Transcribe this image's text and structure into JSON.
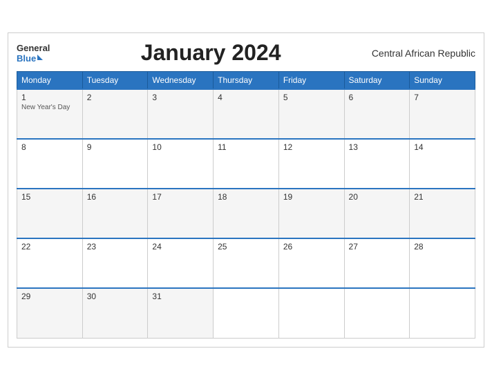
{
  "header": {
    "logo_general": "General",
    "logo_blue": "Blue",
    "title": "January 2024",
    "country": "Central African Republic"
  },
  "weekdays": [
    "Monday",
    "Tuesday",
    "Wednesday",
    "Thursday",
    "Friday",
    "Saturday",
    "Sunday"
  ],
  "weeks": [
    [
      {
        "day": "1",
        "holiday": "New Year's Day"
      },
      {
        "day": "2",
        "holiday": ""
      },
      {
        "day": "3",
        "holiday": ""
      },
      {
        "day": "4",
        "holiday": ""
      },
      {
        "day": "5",
        "holiday": ""
      },
      {
        "day": "6",
        "holiday": ""
      },
      {
        "day": "7",
        "holiday": ""
      }
    ],
    [
      {
        "day": "8",
        "holiday": ""
      },
      {
        "day": "9",
        "holiday": ""
      },
      {
        "day": "10",
        "holiday": ""
      },
      {
        "day": "11",
        "holiday": ""
      },
      {
        "day": "12",
        "holiday": ""
      },
      {
        "day": "13",
        "holiday": ""
      },
      {
        "day": "14",
        "holiday": ""
      }
    ],
    [
      {
        "day": "15",
        "holiday": ""
      },
      {
        "day": "16",
        "holiday": ""
      },
      {
        "day": "17",
        "holiday": ""
      },
      {
        "day": "18",
        "holiday": ""
      },
      {
        "day": "19",
        "holiday": ""
      },
      {
        "day": "20",
        "holiday": ""
      },
      {
        "day": "21",
        "holiday": ""
      }
    ],
    [
      {
        "day": "22",
        "holiday": ""
      },
      {
        "day": "23",
        "holiday": ""
      },
      {
        "day": "24",
        "holiday": ""
      },
      {
        "day": "25",
        "holiday": ""
      },
      {
        "day": "26",
        "holiday": ""
      },
      {
        "day": "27",
        "holiday": ""
      },
      {
        "day": "28",
        "holiday": ""
      }
    ],
    [
      {
        "day": "29",
        "holiday": ""
      },
      {
        "day": "30",
        "holiday": ""
      },
      {
        "day": "31",
        "holiday": ""
      },
      {
        "day": "",
        "holiday": ""
      },
      {
        "day": "",
        "holiday": ""
      },
      {
        "day": "",
        "holiday": ""
      },
      {
        "day": "",
        "holiday": ""
      }
    ]
  ],
  "colors": {
    "header_bg": "#2a74c0",
    "header_text": "#ffffff",
    "cell_odd_bg": "#f5f5f5",
    "cell_even_bg": "#ffffff",
    "accent_blue": "#2a74c0"
  }
}
